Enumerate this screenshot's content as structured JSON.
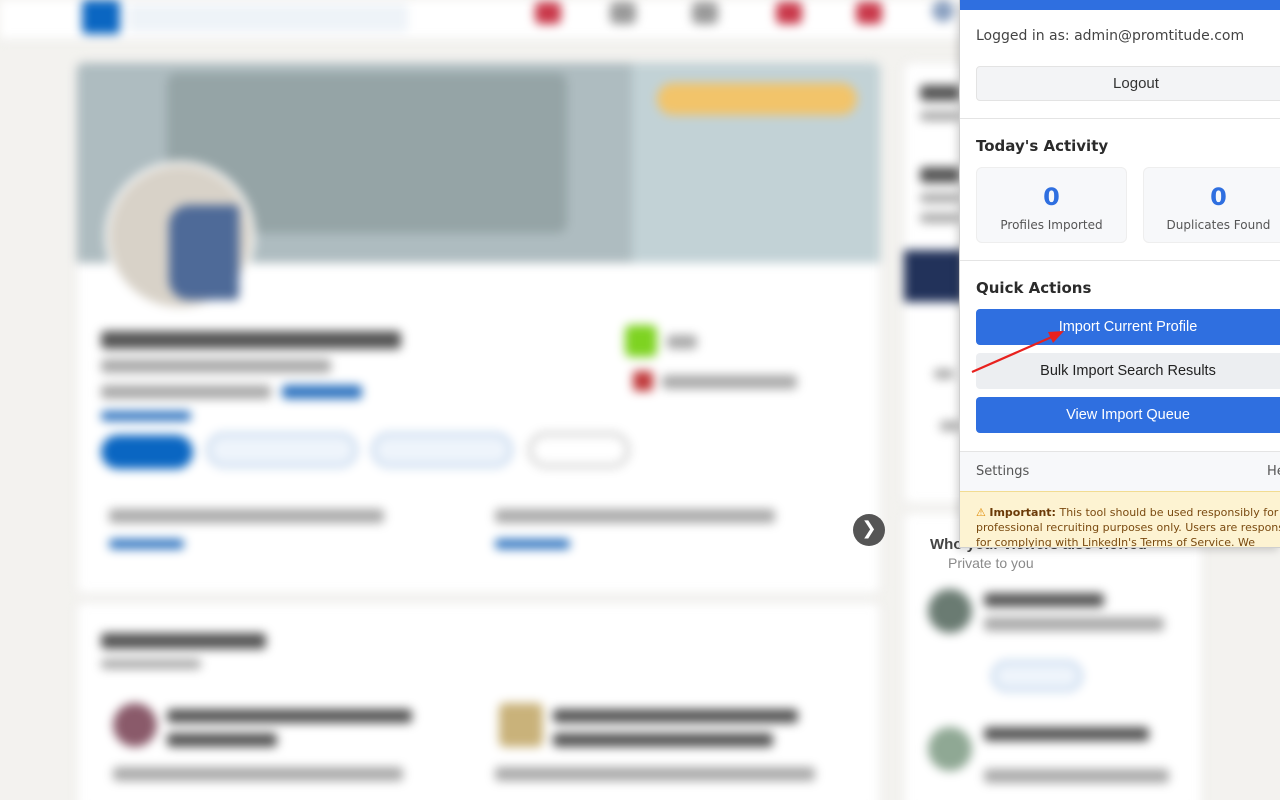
{
  "background": {
    "who_viewed_title": "Who your viewers also viewed",
    "who_viewed_subtitle": "Private to you",
    "carousel_next_glyph": "❯"
  },
  "popup": {
    "logged_in_text": "Logged in as: admin@promtitude.com",
    "logout_label": "Logout",
    "activity": {
      "title": "Today's Activity",
      "stats": [
        {
          "value": "0",
          "label": "Profiles Imported"
        },
        {
          "value": "0",
          "label": "Duplicates Found"
        }
      ]
    },
    "quick_actions": {
      "title": "Quick Actions",
      "import_current": "Import Current Profile",
      "bulk_import": "Bulk Import Search Results",
      "view_queue": "View Import Queue"
    },
    "footer": {
      "settings_label": "Settings",
      "help_label": "He"
    },
    "warning": {
      "icon": "warning-triangle-icon",
      "strong": "Important:",
      "text": "This tool should be used responsibly for professional recruiting purposes only. Users are responsible for complying with LinkedIn's Terms of Service. We recommend"
    },
    "colors": {
      "primary": "#2f6fe0",
      "warning_bg": "#fdf3d2",
      "annotation_arrow": "#e8211e"
    }
  }
}
